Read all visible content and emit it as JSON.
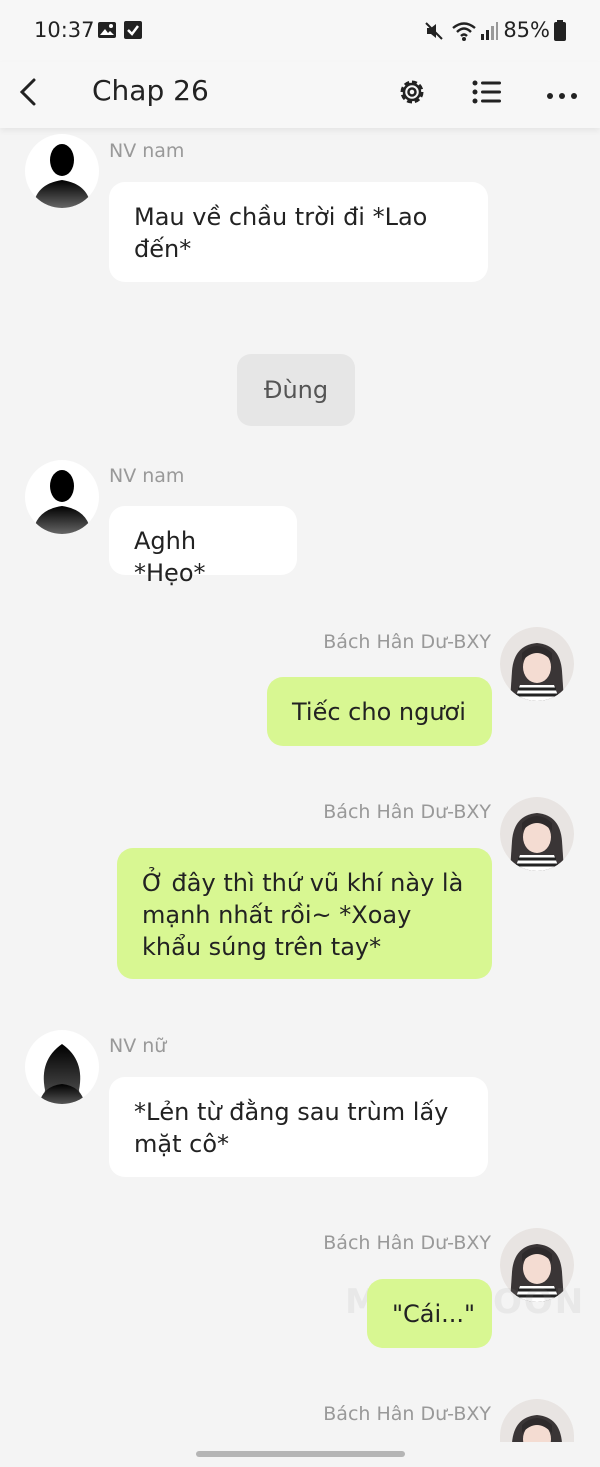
{
  "status": {
    "time": "10:37",
    "battery": "85%"
  },
  "header": {
    "title": "Chap 26"
  },
  "messages": [
    {
      "sender": "NV nam",
      "text": "Mau về chầu trời đi *Lao đến*",
      "side": "left"
    },
    {
      "center": "Đùng"
    },
    {
      "sender": "NV nam",
      "text": "Aghh *Hẹo*",
      "side": "left"
    },
    {
      "sender": "Bách Hân Dư-BXY",
      "text": "Tiếc cho ngươi",
      "side": "right"
    },
    {
      "sender": "Bách Hân Dư-BXY",
      "text": "Ở đây thì thứ vũ khí này là mạnh nhất rồi~ *Xoay khẩu súng trên tay*",
      "side": "right"
    },
    {
      "sender": "NV nữ",
      "text": "*Lẻn từ đằng sau trùm lấy mặt cô*",
      "side": "left"
    },
    {
      "sender": "Bách Hân Dư-BXY",
      "text": "\"Cái...\"",
      "side": "right"
    },
    {
      "sender": "Bách Hân Dư-BXY",
      "side": "right"
    }
  ],
  "watermark": "MAKEDOON",
  "colors": {
    "right_bubble": "#d8f792",
    "left_bubble": "#ffffff",
    "background": "#f4f4f4"
  },
  "icons": [
    "image-icon",
    "checkbox-icon",
    "mute-icon",
    "wifi-icon",
    "signal-icon",
    "battery-icon",
    "back-icon",
    "gear-icon",
    "list-icon",
    "more-icon"
  ]
}
